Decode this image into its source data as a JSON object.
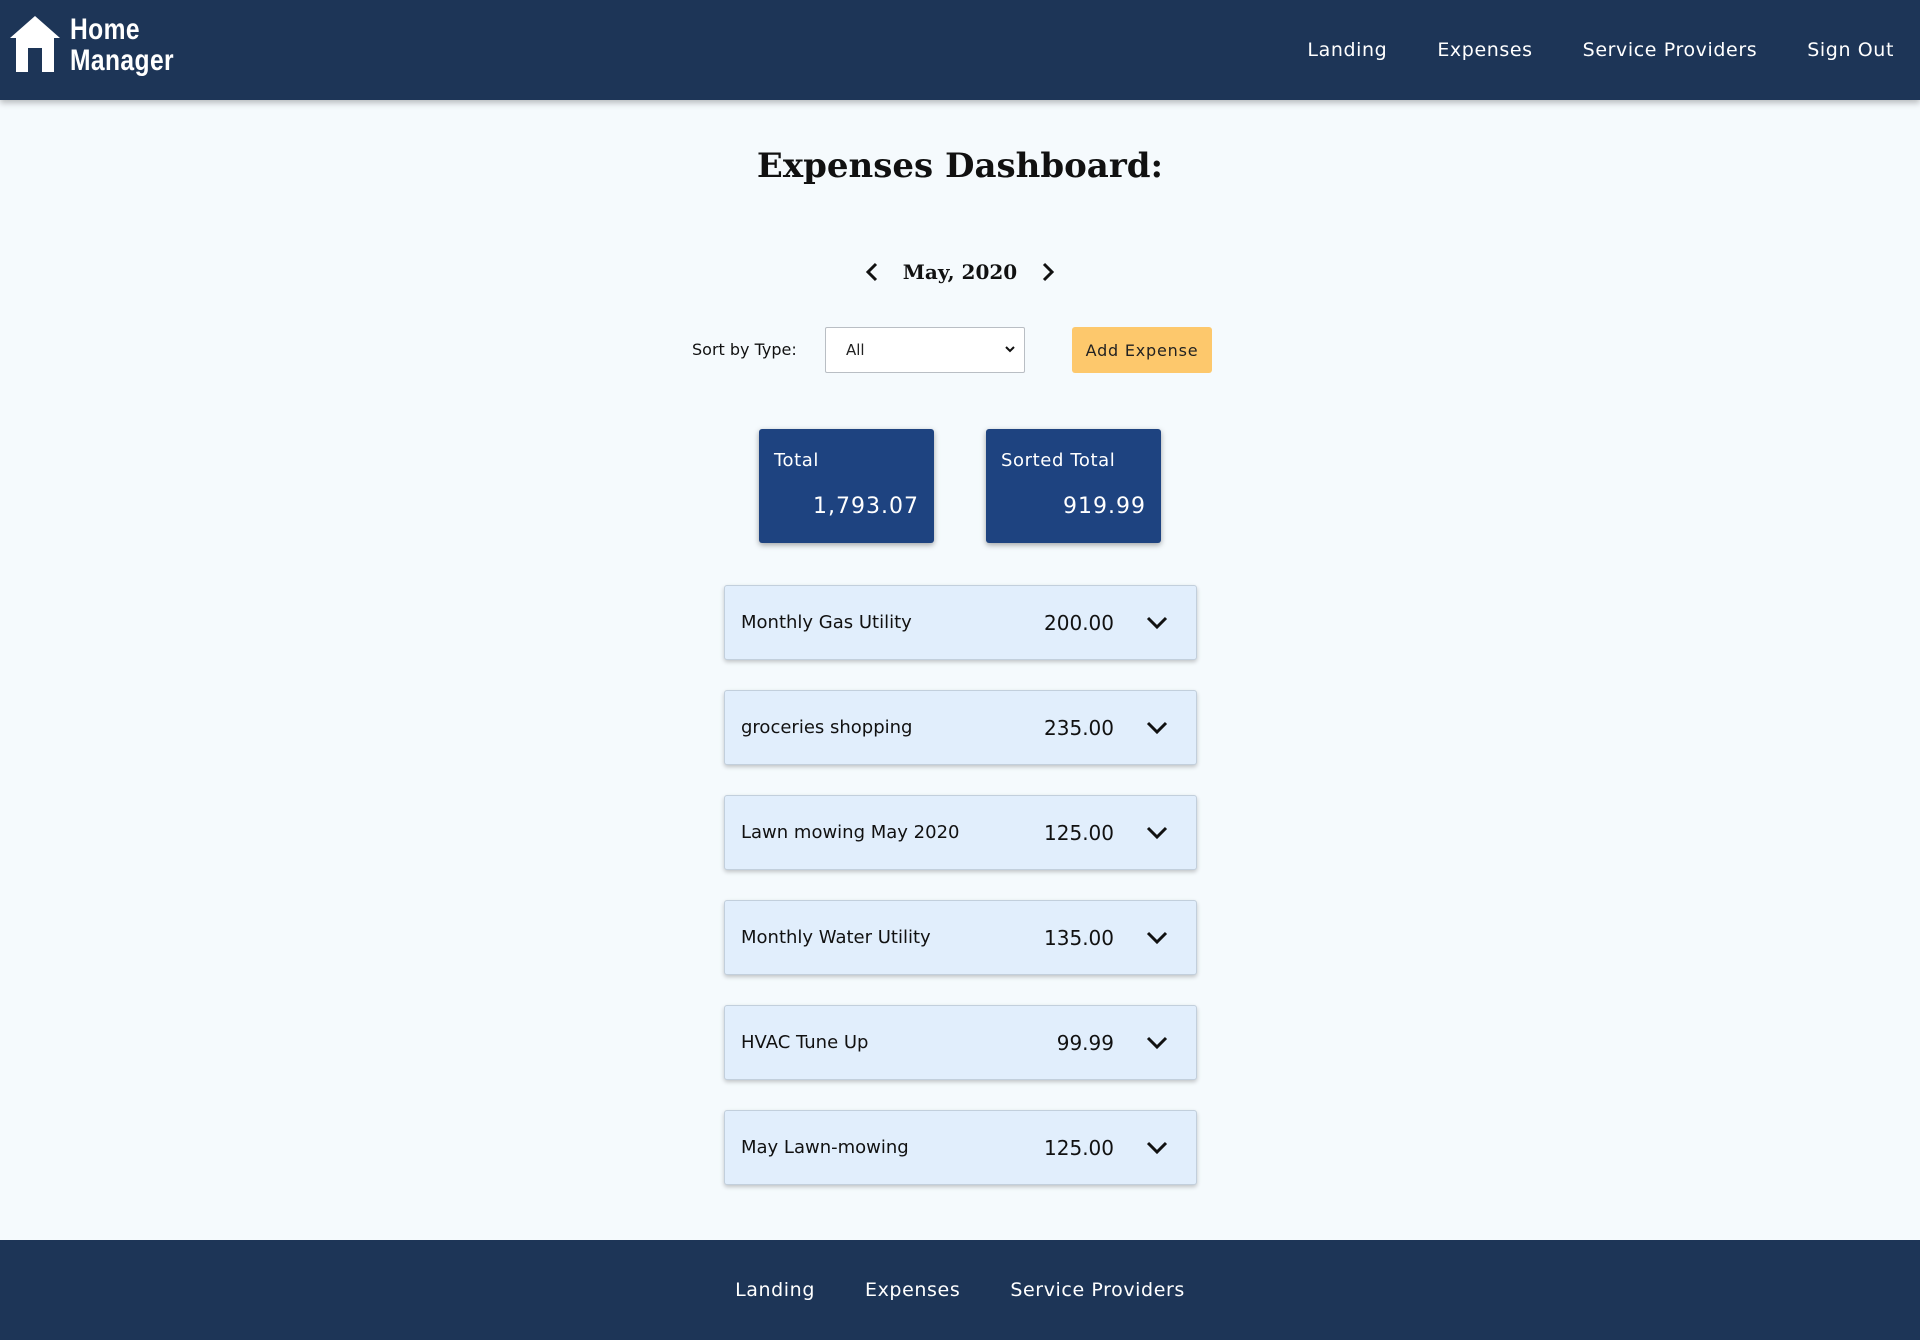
{
  "header": {
    "logo_line1": "Home",
    "logo_line2": "Manager",
    "logo_icon": "house-icon",
    "nav": [
      "Landing",
      "Expenses",
      "Service Providers",
      "Sign Out"
    ]
  },
  "page": {
    "title": "Expenses Dashboard:"
  },
  "month_nav": {
    "label": "May, 2020",
    "prev_icon": "chevron-left-icon",
    "next_icon": "chevron-right-icon"
  },
  "controls": {
    "sort_label": "Sort by Type:",
    "sort_value": "All",
    "add_button": "Add Expense"
  },
  "totals": {
    "total_label": "Total",
    "total_value": "1,793.07",
    "sorted_label": "Sorted Total",
    "sorted_value": "919.99"
  },
  "expenses": [
    {
      "name": "Monthly Gas Utility",
      "amount": "200.00"
    },
    {
      "name": "groceries shopping",
      "amount": "235.00"
    },
    {
      "name": "Lawn mowing May 2020",
      "amount": "125.00"
    },
    {
      "name": "Monthly Water Utility",
      "amount": "135.00"
    },
    {
      "name": "HVAC Tune Up",
      "amount": "99.99"
    },
    {
      "name": "May Lawn-mowing",
      "amount": "125.00"
    }
  ],
  "footer": {
    "nav": [
      "Landing",
      "Expenses",
      "Service Providers"
    ]
  },
  "colors": {
    "header_bg": "#1d3557",
    "card_bg": "#1e4380",
    "accent_button": "#fdc86c",
    "expense_bg": "#e1eefc",
    "page_bg": "#f5fafd"
  }
}
